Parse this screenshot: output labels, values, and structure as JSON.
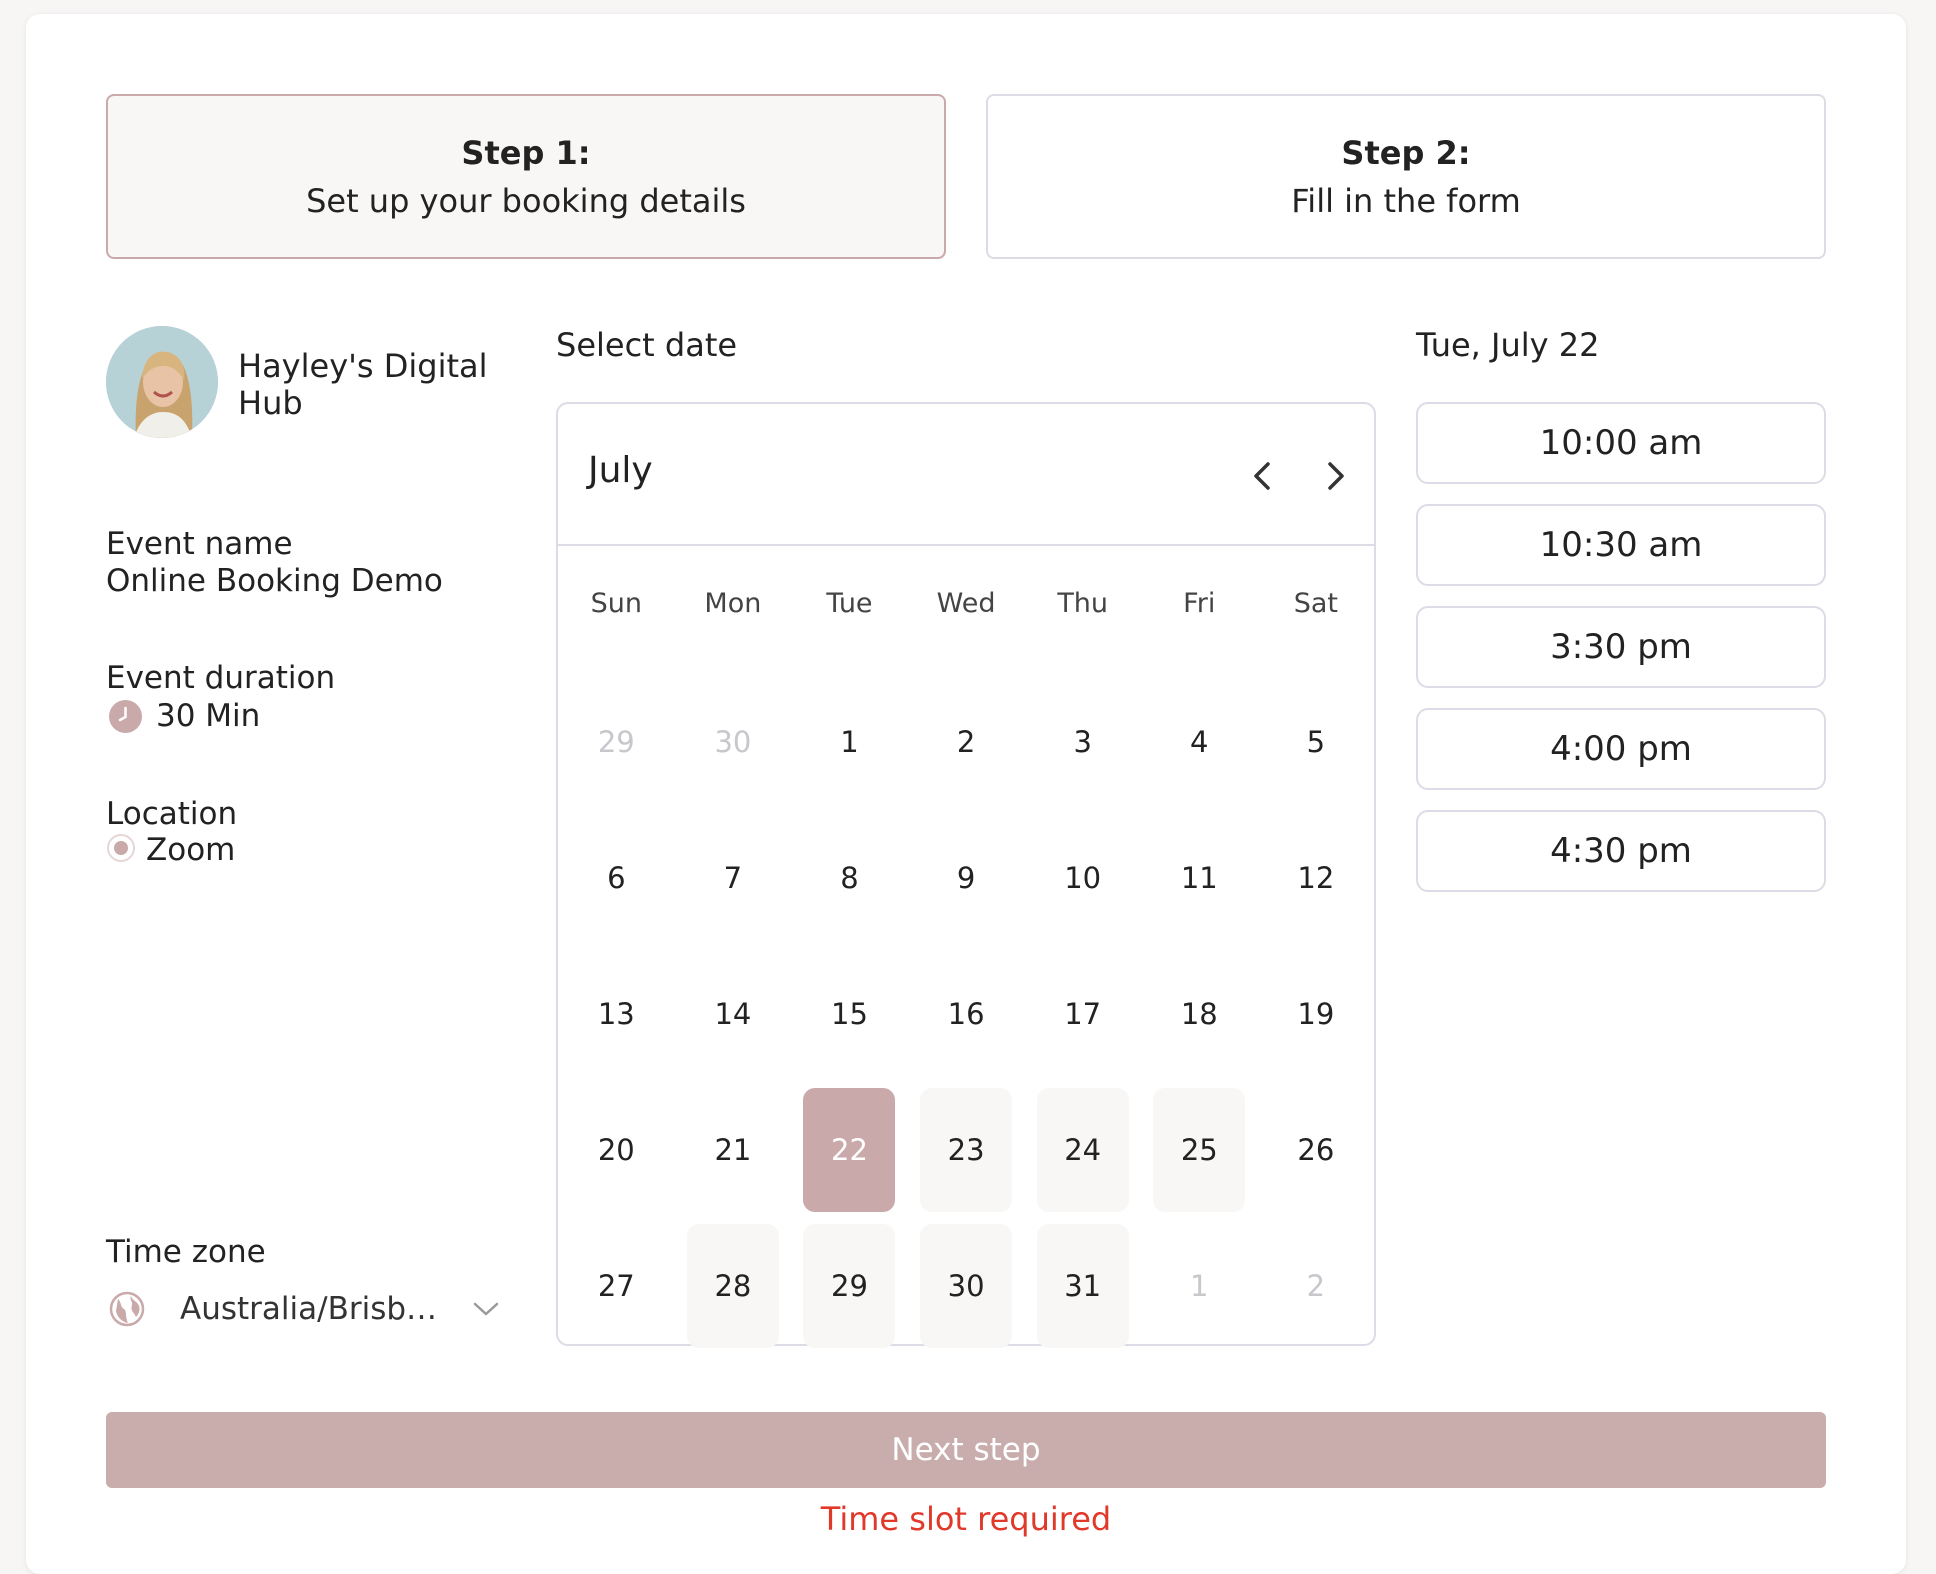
{
  "steps": [
    {
      "title": "Step 1:",
      "subtitle": "Set up your booking details"
    },
    {
      "title": "Step 2:",
      "subtitle": "Fill in the form"
    }
  ],
  "organizer": {
    "name_line1": "Hayley's Digital",
    "name_line2": "Hub"
  },
  "event": {
    "name_label": "Event name",
    "name_value": "Online Booking Demo",
    "duration_label": "Event duration",
    "duration_value": "30 Min",
    "location_label": "Location",
    "location_value": "Zoom"
  },
  "timezone": {
    "label": "Time zone",
    "value": "Australia/Brisb…"
  },
  "calendar": {
    "select_label": "Select date",
    "month": "July",
    "weekdays": [
      "Sun",
      "Mon",
      "Tue",
      "Wed",
      "Thu",
      "Fri",
      "Sat"
    ],
    "days": [
      {
        "n": "29",
        "state": "muted"
      },
      {
        "n": "30",
        "state": "muted"
      },
      {
        "n": "1",
        "state": "normal"
      },
      {
        "n": "2",
        "state": "normal"
      },
      {
        "n": "3",
        "state": "normal"
      },
      {
        "n": "4",
        "state": "normal"
      },
      {
        "n": "5",
        "state": "normal"
      },
      {
        "n": "6",
        "state": "normal"
      },
      {
        "n": "7",
        "state": "normal"
      },
      {
        "n": "8",
        "state": "normal"
      },
      {
        "n": "9",
        "state": "normal"
      },
      {
        "n": "10",
        "state": "normal"
      },
      {
        "n": "11",
        "state": "normal"
      },
      {
        "n": "12",
        "state": "normal"
      },
      {
        "n": "13",
        "state": "normal"
      },
      {
        "n": "14",
        "state": "normal"
      },
      {
        "n": "15",
        "state": "normal"
      },
      {
        "n": "16",
        "state": "normal"
      },
      {
        "n": "17",
        "state": "normal"
      },
      {
        "n": "18",
        "state": "normal"
      },
      {
        "n": "19",
        "state": "normal"
      },
      {
        "n": "20",
        "state": "normal"
      },
      {
        "n": "21",
        "state": "normal"
      },
      {
        "n": "22",
        "state": "selected"
      },
      {
        "n": "23",
        "state": "available"
      },
      {
        "n": "24",
        "state": "available"
      },
      {
        "n": "25",
        "state": "available"
      },
      {
        "n": "26",
        "state": "normal"
      },
      {
        "n": "27",
        "state": "normal"
      },
      {
        "n": "28",
        "state": "available"
      },
      {
        "n": "29",
        "state": "available"
      },
      {
        "n": "30",
        "state": "available"
      },
      {
        "n": "31",
        "state": "available"
      },
      {
        "n": "1",
        "state": "muted"
      },
      {
        "n": "2",
        "state": "muted"
      }
    ]
  },
  "slots": {
    "date_label": "Tue, July 22",
    "times": [
      "10:00 am",
      "10:30 am",
      "3:30 pm",
      "4:00 pm",
      "4:30 pm"
    ]
  },
  "actions": {
    "next_label": "Next step",
    "error": "Time slot required"
  },
  "colors": {
    "accent": "#c9a9a9",
    "error": "#e0392a",
    "border": "#dcdce6"
  },
  "icons": {
    "prev": "chevron-left-icon",
    "next": "chevron-right-icon",
    "clock": "clock-icon",
    "location": "location-pin-icon",
    "timezone": "globe-icon",
    "dropdown": "chevron-down-icon"
  }
}
